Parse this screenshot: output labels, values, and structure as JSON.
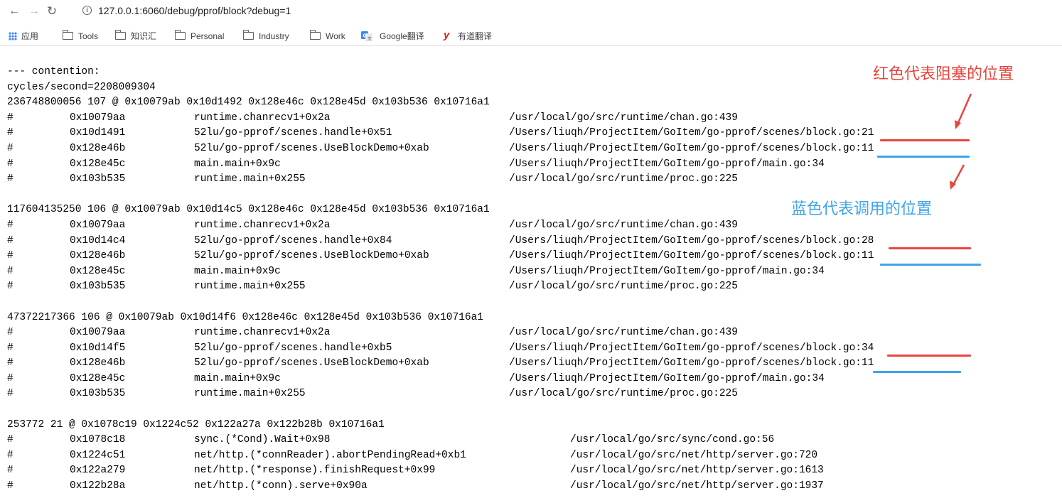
{
  "browser": {
    "url": "127.0.0.1:6060/debug/pprof/block?debug=1",
    "icons": [
      "back-arrow-icon",
      "forward-arrow-icon",
      "reload-icon",
      "info-icon"
    ]
  },
  "bookmarks": [
    {
      "label": "应用",
      "icon": "apps-grid-icon"
    },
    {
      "label": "Tools",
      "icon": "folder-icon"
    },
    {
      "label": "知识汇",
      "icon": "folder-icon"
    },
    {
      "label": "Personal",
      "icon": "folder-icon"
    },
    {
      "label": "Industry",
      "icon": "folder-icon"
    },
    {
      "label": "Work",
      "icon": "folder-icon"
    },
    {
      "label": "Google翻译",
      "icon": "google-translate-icon"
    },
    {
      "label": "有道翻译",
      "icon": "youdao-icon"
    }
  ],
  "profile": {
    "header": "--- contention:",
    "cycles": "cycles/second=2208009304",
    "blocks": [
      {
        "summary": "236748800056 107 @ 0x10079ab 0x10d1492 0x128e46c 0x128e45d 0x103b536 0x10716a1",
        "frames": [
          {
            "addr": "0x10079aa",
            "func": "runtime.chanrecv1+0x2a",
            "path": "/usr/local/go/src/runtime/chan.go:439"
          },
          {
            "addr": "0x10d1491",
            "func": "52lu/go-pprof/scenes.handle+0x51",
            "path": "/Users/liuqh/ProjectItem/GoItem/go-pprof/scenes/block.go:21"
          },
          {
            "addr": "0x128e46b",
            "func": "52lu/go-pprof/scenes.UseBlockDemo+0xab",
            "path": "/Users/liuqh/ProjectItem/GoItem/go-pprof/scenes/block.go:11"
          },
          {
            "addr": "0x128e45c",
            "func": "main.main+0x9c",
            "path": "/Users/liuqh/ProjectItem/GoItem/go-pprof/main.go:34"
          },
          {
            "addr": "0x103b535",
            "func": "runtime.main+0x255",
            "path": "/usr/local/go/src/runtime/proc.go:225"
          }
        ]
      },
      {
        "summary": "117604135250 106 @ 0x10079ab 0x10d14c5 0x128e46c 0x128e45d 0x103b536 0x10716a1",
        "frames": [
          {
            "addr": "0x10079aa",
            "func": "runtime.chanrecv1+0x2a",
            "path": "/usr/local/go/src/runtime/chan.go:439"
          },
          {
            "addr": "0x10d14c4",
            "func": "52lu/go-pprof/scenes.handle+0x84",
            "path": "/Users/liuqh/ProjectItem/GoItem/go-pprof/scenes/block.go:28"
          },
          {
            "addr": "0x128e46b",
            "func": "52lu/go-pprof/scenes.UseBlockDemo+0xab",
            "path": "/Users/liuqh/ProjectItem/GoItem/go-pprof/scenes/block.go:11"
          },
          {
            "addr": "0x128e45c",
            "func": "main.main+0x9c",
            "path": "/Users/liuqh/ProjectItem/GoItem/go-pprof/main.go:34"
          },
          {
            "addr": "0x103b535",
            "func": "runtime.main+0x255",
            "path": "/usr/local/go/src/runtime/proc.go:225"
          }
        ]
      },
      {
        "summary": "47372217366 106 @ 0x10079ab 0x10d14f6 0x128e46c 0x128e45d 0x103b536 0x10716a1",
        "frames": [
          {
            "addr": "0x10079aa",
            "func": "runtime.chanrecv1+0x2a",
            "path": "/usr/local/go/src/runtime/chan.go:439"
          },
          {
            "addr": "0x10d14f5",
            "func": "52lu/go-pprof/scenes.handle+0xb5",
            "path": "/Users/liuqh/ProjectItem/GoItem/go-pprof/scenes/block.go:34"
          },
          {
            "addr": "0x128e46b",
            "func": "52lu/go-pprof/scenes.UseBlockDemo+0xab",
            "path": "/Users/liuqh/ProjectItem/GoItem/go-pprof/scenes/block.go:11"
          },
          {
            "addr": "0x128e45c",
            "func": "main.main+0x9c",
            "path": "/Users/liuqh/ProjectItem/GoItem/go-pprof/main.go:34"
          },
          {
            "addr": "0x103b535",
            "func": "runtime.main+0x255",
            "path": "/usr/local/go/src/runtime/proc.go:225"
          }
        ]
      },
      {
        "summary": "253772 21 @ 0x1078c19 0x1224c52 0x122a27a 0x122b28b 0x10716a1",
        "frames": [
          {
            "addr": "0x1078c18",
            "func": "sync.(*Cond).Wait+0x98",
            "path": "/usr/local/go/src/sync/cond.go:56"
          },
          {
            "addr": "0x1224c51",
            "func": "net/http.(*connReader).abortPendingRead+0xb1",
            "path": "/usr/local/go/src/net/http/server.go:720"
          },
          {
            "addr": "0x122a279",
            "func": "net/http.(*response).finishRequest+0x99",
            "path": "/usr/local/go/src/net/http/server.go:1613"
          },
          {
            "addr": "0x122b28a",
            "func": "net/http.(*conn).serve+0x90a",
            "path": "/usr/local/go/src/net/http/server.go:1937"
          }
        ]
      }
    ]
  },
  "annotations": {
    "red": {
      "text": "红色代表阻塞的位置",
      "color": "#e8453c"
    },
    "blue": {
      "text": "蓝色代表调用的位置",
      "color": "#3fa4e8"
    }
  }
}
